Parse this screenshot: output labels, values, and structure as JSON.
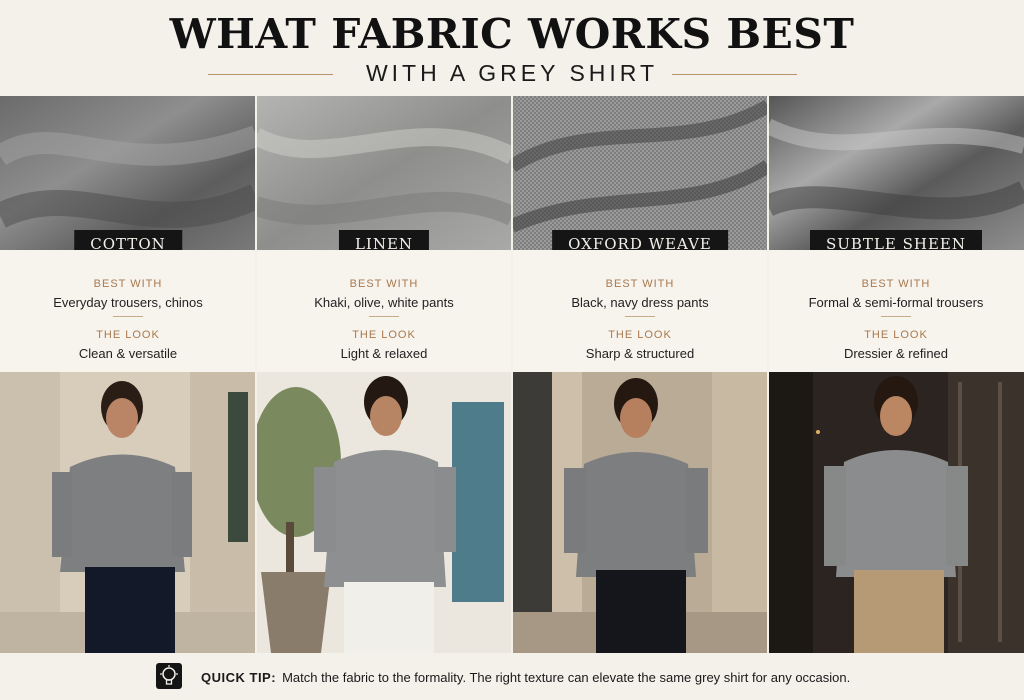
{
  "title": "WHAT FABRIC WORKS BEST",
  "subtitle": "WITH A GREY SHIRT",
  "best_with_label": "BEST WITH",
  "the_look_label": "THE LOOK",
  "columns": [
    {
      "name": "COTTON",
      "best_with": "Everyday trousers, chinos",
      "the_look": "Clean & versatile"
    },
    {
      "name": "LINEN",
      "best_with": "Khaki, olive, white pants",
      "the_look": "Light & relaxed"
    },
    {
      "name": "OXFORD WEAVE",
      "best_with": "Black, navy dress pants",
      "the_look": "Sharp & structured"
    },
    {
      "name": "SUBTLE SHEEN",
      "best_with": "Formal & semi-formal trousers",
      "the_look": "Dressier & refined"
    }
  ],
  "tip": {
    "label": "QUICK TIP:",
    "text": "Match the fabric to the formality. The right texture can elevate the same grey shirt for any occasion.",
    "icon": "lightbulb-icon"
  },
  "colors": {
    "background": "#f4f0ea",
    "accent": "#a8794e",
    "label_bg": "#151515"
  }
}
